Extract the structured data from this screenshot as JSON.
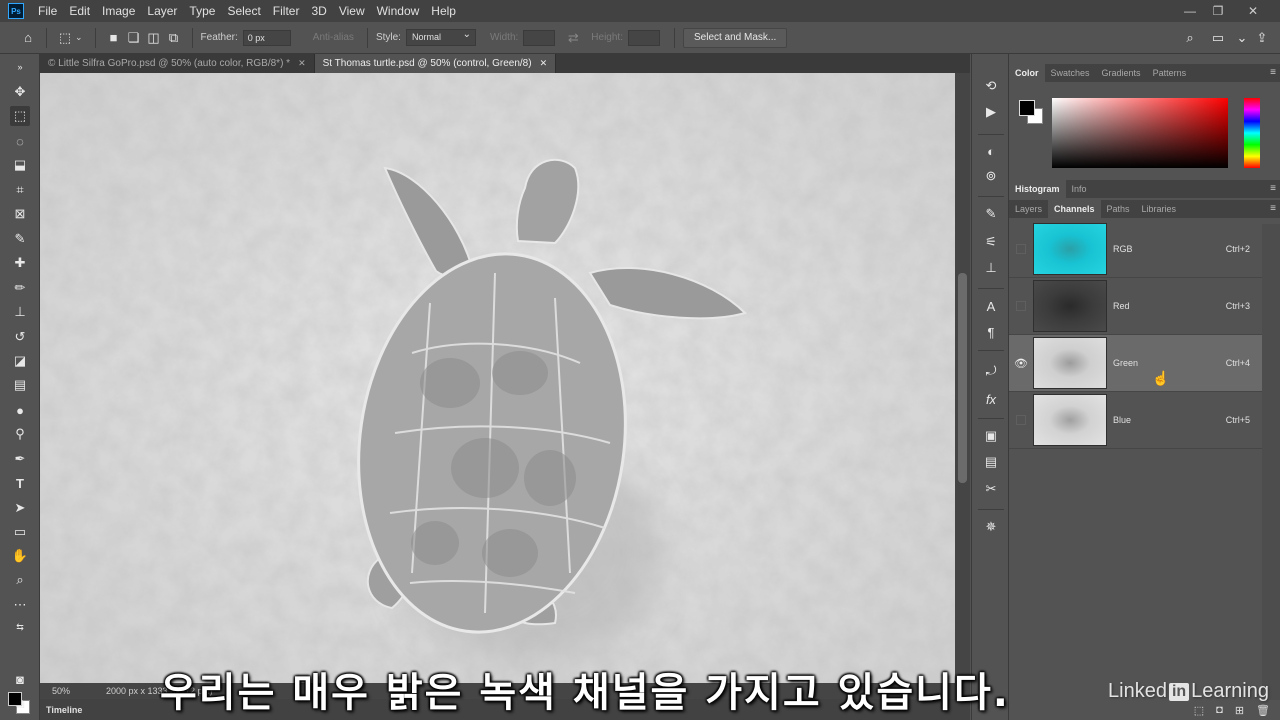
{
  "app": {
    "logo": "Ps",
    "menu": [
      "File",
      "Edit",
      "Image",
      "Layer",
      "Type",
      "Select",
      "Filter",
      "3D",
      "View",
      "Window",
      "Help"
    ]
  },
  "options": {
    "feather_label": "Feather:",
    "feather_value": "0 px",
    "antialias_label": "Anti-alias",
    "style_label": "Style:",
    "style_value": "Normal",
    "width_label": "Width:",
    "height_label": "Height:",
    "select_mask_button": "Select and Mask..."
  },
  "tabs": [
    {
      "label": "© Little Silfra GoPro.psd @ 50% (auto color, RGB/8*) *"
    },
    {
      "label": "St Thomas turtle.psd @ 50% (control, Green/8)"
    }
  ],
  "status": {
    "zoom": "50%",
    "doc_info": "2000 px x 1333 px (72 ppi)"
  },
  "timeline": {
    "label": "Timeline"
  },
  "color_panel": {
    "tabs": [
      "Color",
      "Swatches",
      "Gradients",
      "Patterns"
    ],
    "fg": "#000000",
    "bg": "#ffffff"
  },
  "histogram_panel": {
    "tabs": [
      "Histogram",
      "Info"
    ]
  },
  "layers_panel": {
    "tabs": [
      "Layers",
      "Channels",
      "Paths",
      "Libraries"
    ],
    "channels": [
      {
        "name": "RGB",
        "shortcut": "Ctrl+2",
        "visible": false,
        "selected": false
      },
      {
        "name": "Red",
        "shortcut": "Ctrl+3",
        "visible": false,
        "selected": false
      },
      {
        "name": "Green",
        "shortcut": "Ctrl+4",
        "visible": true,
        "selected": true
      },
      {
        "name": "Blue",
        "shortcut": "Ctrl+5",
        "visible": false,
        "selected": false
      }
    ]
  },
  "subtitle": "우리는 매우 밝은 녹색 채널을 가지고 있습니다.",
  "watermark": {
    "prefix": "Linked",
    "in": "in",
    "suffix": " Learning"
  },
  "colors": {
    "accent": "#31a8ff",
    "panel_bg": "#535353",
    "menubar_bg": "#424242"
  }
}
